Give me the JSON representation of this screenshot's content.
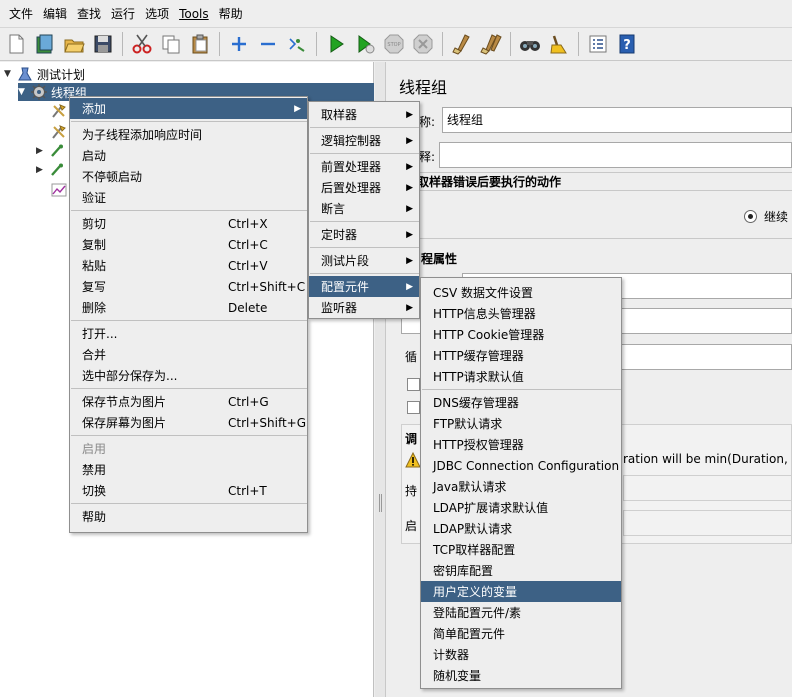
{
  "menubar": {
    "items": [
      "文件",
      "编辑",
      "查找",
      "运行",
      "选项",
      "Tools",
      "帮助"
    ]
  },
  "toolbar": {
    "icons": [
      "new-icon",
      "templates-icon",
      "open-icon",
      "save-icon",
      "cut-icon",
      "copy-icon",
      "paste-icon",
      "expand-icon",
      "collapse-icon",
      "toggle-icon",
      "start-icon",
      "start-no-pause-icon",
      "stop-icon",
      "shutdown-icon",
      "clear-icon",
      "clear-all-icon",
      "search-icon",
      "reset-search-icon",
      "function-helper-icon",
      "help-icon"
    ]
  },
  "tree": {
    "root": "测试计划",
    "thread_group": "线程组"
  },
  "right_panel": {
    "title": "线程组",
    "name_label": "称:",
    "name_value": "线程组",
    "comment_label": "释:",
    "sampler_error_section": "取样器错误后要执行的动作",
    "continue_option": "继续",
    "thread_props_section": "程属性",
    "loop_label": "循",
    "schedule_label": "调",
    "duration_label": "持",
    "delay_label": "启",
    "warning_text": "ration will be min(Duration, Loo"
  },
  "context_menu": {
    "items": [
      {
        "label": "添加",
        "submenu": true
      },
      {
        "label": "为子线程添加响应时间"
      },
      {
        "label": "启动"
      },
      {
        "label": "不停顿启动"
      },
      {
        "label": "验证"
      },
      {
        "label": "剪切",
        "accel": "Ctrl+X"
      },
      {
        "label": "复制",
        "accel": "Ctrl+C"
      },
      {
        "label": "粘贴",
        "accel": "Ctrl+V"
      },
      {
        "label": "复写",
        "accel": "Ctrl+Shift+C"
      },
      {
        "label": "删除",
        "accel": "Delete"
      },
      {
        "label": "打开..."
      },
      {
        "label": "合并"
      },
      {
        "label": "选中部分保存为..."
      },
      {
        "label": "保存节点为图片",
        "accel": "Ctrl+G"
      },
      {
        "label": "保存屏幕为图片",
        "accel": "Ctrl+Shift+G"
      },
      {
        "label": "启用",
        "disabled": true
      },
      {
        "label": "禁用"
      },
      {
        "label": "切换",
        "accel": "Ctrl+T"
      },
      {
        "label": "帮助"
      }
    ]
  },
  "add_submenu": {
    "items": [
      "取样器",
      "逻辑控制器",
      "前置处理器",
      "后置处理器",
      "断言",
      "定时器",
      "测试片段",
      "配置元件",
      "监听器"
    ]
  },
  "config_submenu": {
    "items": [
      "CSV 数据文件设置",
      "HTTP信息头管理器",
      "HTTP Cookie管理器",
      "HTTP缓存管理器",
      "HTTP请求默认值",
      "DNS缓存管理器",
      "FTP默认请求",
      "HTTP授权管理器",
      "JDBC Connection Configuration",
      "Java默认请求",
      "LDAP扩展请求默认值",
      "LDAP默认请求",
      "TCP取样器配置",
      "密钥库配置",
      "用户定义的变量",
      "登陆配置元件/素",
      "简单配置元件",
      "计数器",
      "随机变量"
    ]
  },
  "colors": {
    "highlight": "#3d6185",
    "menu_bg": "#eeeeee",
    "pane_bg": "#ffffff"
  }
}
